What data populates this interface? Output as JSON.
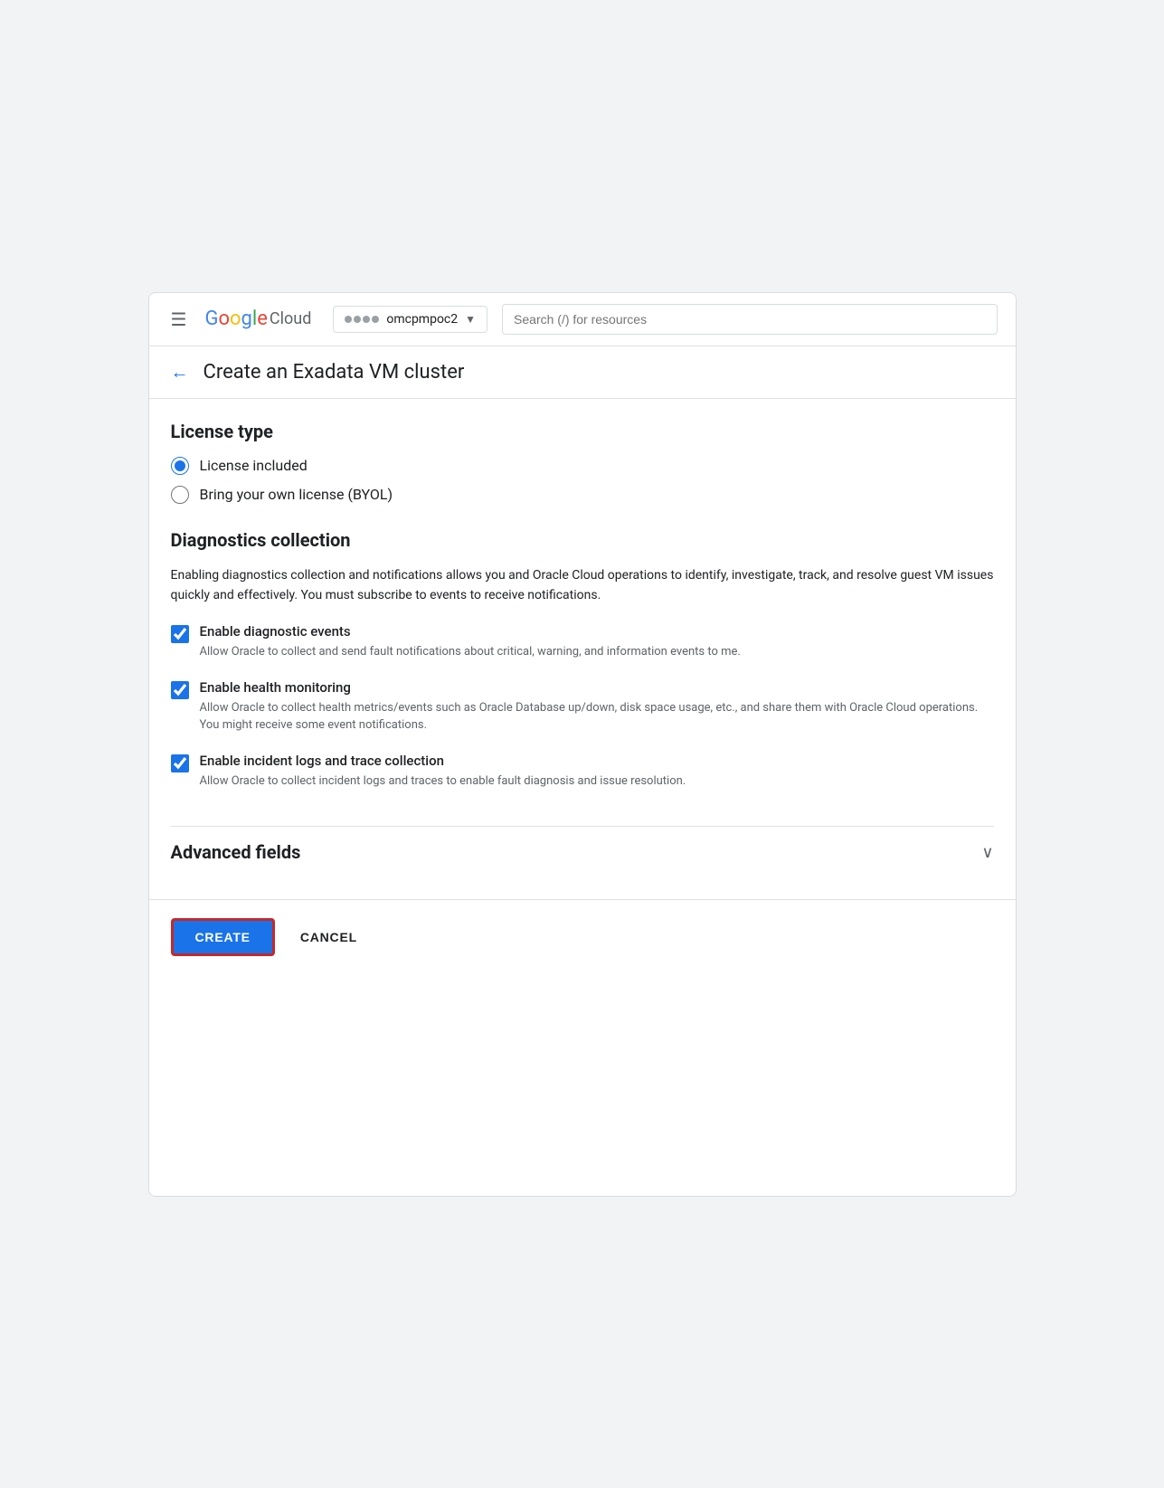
{
  "nav": {
    "hamburger": "☰",
    "google_text": "Google",
    "cloud_text": "Cloud",
    "project_name": "omcpmpoc2",
    "search_placeholder": "Search (/) for resources"
  },
  "header": {
    "back_label": "←",
    "title": "Create an Exadata VM cluster"
  },
  "license_section": {
    "title": "License type",
    "options": [
      {
        "id": "license-included",
        "label": "License included",
        "checked": true
      },
      {
        "id": "byol",
        "label": "Bring your own license (BYOL)",
        "checked": false
      }
    ]
  },
  "diagnostics_section": {
    "title": "Diagnostics collection",
    "description": "Enabling diagnostics collection and notifications allows you and Oracle Cloud operations to identify, investigate, track, and resolve guest VM issues quickly and effectively. You must subscribe to events to receive notifications.",
    "checkboxes": [
      {
        "id": "diag-events",
        "label": "Enable diagnostic events",
        "description": "Allow Oracle to collect and send fault notifications about critical, warning, and information events to me.",
        "checked": true
      },
      {
        "id": "health-monitoring",
        "label": "Enable health monitoring",
        "description": "Allow Oracle to collect health metrics/events such as Oracle Database up/down, disk space usage, etc., and share them with Oracle Cloud operations. You might receive some event notifications.",
        "checked": true
      },
      {
        "id": "incident-logs",
        "label": "Enable incident logs and trace collection",
        "description": "Allow Oracle to collect incident logs and traces to enable fault diagnosis and issue resolution.",
        "checked": true
      }
    ]
  },
  "advanced_fields": {
    "title": "Advanced fields",
    "chevron": "∨"
  },
  "footer": {
    "create_label": "CREATE",
    "cancel_label": "CANCEL"
  }
}
